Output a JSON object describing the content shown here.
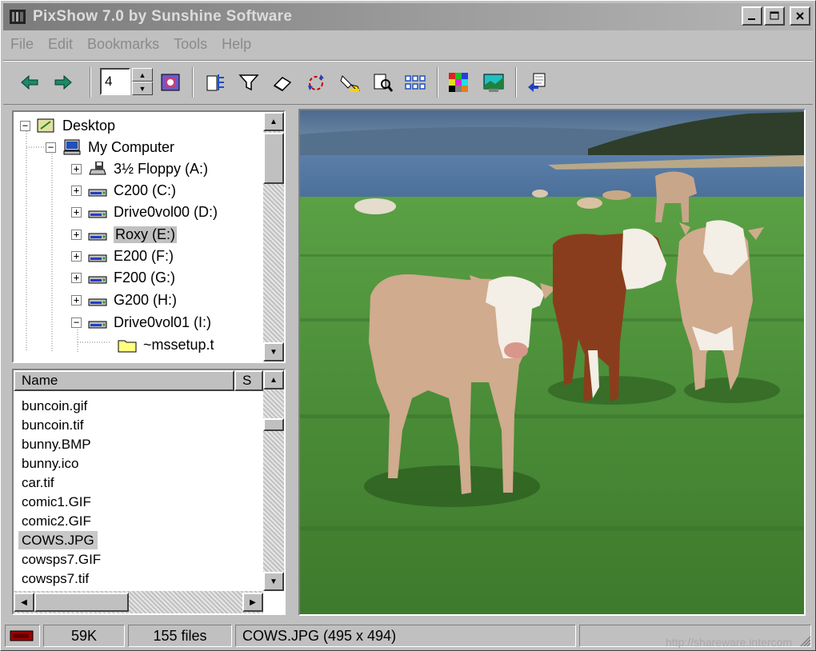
{
  "window": {
    "title": "PixShow 7.0 by Sunshine Software"
  },
  "menu": [
    "File",
    "Edit",
    "Bookmarks",
    "Tools",
    "Help"
  ],
  "toolbar": {
    "spin_value": "4"
  },
  "tree": {
    "root": "Desktop",
    "computer": "My Computer",
    "drives": [
      "3½ Floppy (A:)",
      "C200 (C:)",
      "Drive0vol00 (D:)",
      "Roxy (E:)",
      "E200 (F:)",
      "F200 (G:)",
      "G200 (H:)",
      "Drive0vol01 (I:)"
    ],
    "folder": "~mssetup.t"
  },
  "filelist": {
    "headers": [
      "Name",
      "S"
    ],
    "files": [
      "buncoin.gif",
      "buncoin.tif",
      "bunny.BMP",
      "bunny.ico",
      "car.tif",
      "comic1.GIF",
      "comic2.GIF",
      "COWS.JPG",
      "cowsps7.GIF",
      "cowsps7.tif"
    ],
    "selected": "COWS.JPG"
  },
  "status": {
    "size": "59K",
    "count": "155 files",
    "info": "COWS.JPG  (495 x 494)",
    "watermark": "http://shareware.intercom"
  }
}
